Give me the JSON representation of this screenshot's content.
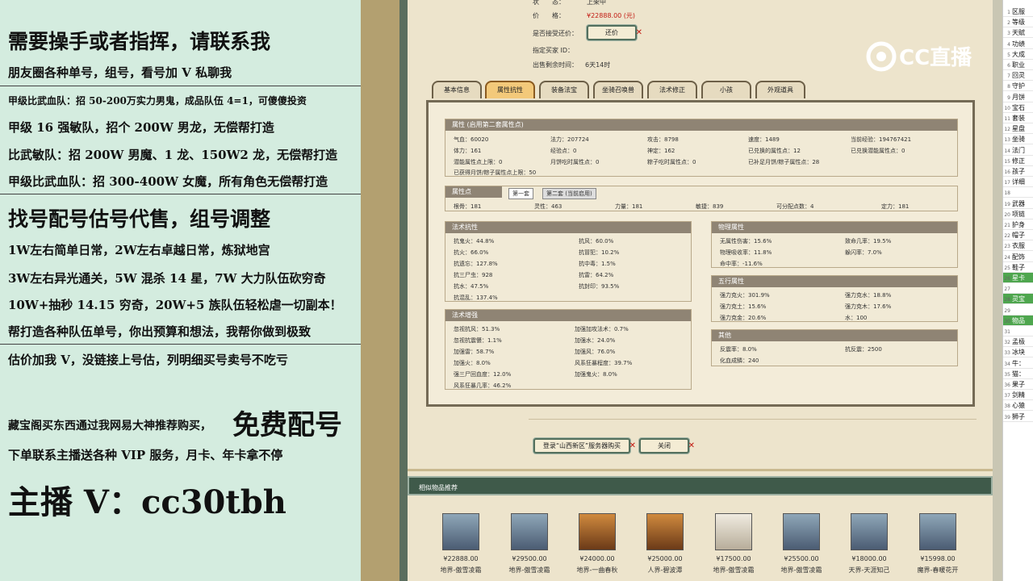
{
  "left": {
    "lines": [
      "需要操手或者指挥，请联系我",
      "朋友圈各种单号，组号，看号加 V 私聊我",
      "甲级比武血队：招 50-200万实力男鬼，成品队伍 4=1，可傻傻投资",
      "甲级 16 强敏队，招个 200W 男龙，无偿帮打造",
      "比武敏队：招 200W 男魔、1 龙、150W2 龙，无偿帮打造",
      "甲级比武血队：招 300-400W 女魔，所有角色无偿帮打造",
      "找号配号估号代售，组号调整",
      "1W左右简单日常，2W左右卓越日常，炼狱地宫",
      "3W左右异光通关，5W 混杀 14 星，7W 大力队伍砍穷奇",
      "10W+抽秒 14.15 穷奇，20W+5 族队伍轻松虐一切副本！",
      "帮打造各种队伍单号，你出预算和想法，我帮你做到极致",
      "估价加我 V，没链接上号估，列明细买号卖号不吃亏",
      "藏宝阁买东西通过我网易大神推荐购买，",
      "免费配号",
      "下单联系主播送各种 VIP 服务，月卡、年卡拿不停",
      "主播 V：cc30tbh"
    ]
  },
  "top": {
    "status_label": "状　　态：",
    "status_value": "上架中",
    "price_label": "价　　格：",
    "price_value": "¥22888.00 (元)",
    "counter_label": "是否接受还价：",
    "counter_btn": "还价",
    "buyer_label": "指定买家 ID：",
    "remain_label": "出售剩余时间：",
    "remain_value": "6天14时"
  },
  "tabs": [
    "基本信息",
    "属性抗性",
    "装备法宝",
    "坐骑召唤兽",
    "法术修正",
    "小孩",
    "外观道具"
  ],
  "attr": {
    "header": "属性 (启用第二套属性点)",
    "rows": [
      [
        [
          "气血：60020"
        ],
        [
          "法力：207724"
        ],
        [
          "攻击：8798"
        ],
        [
          "速度：1489"
        ],
        [
          "当前经验：194767421"
        ]
      ],
      [
        [
          "体力：161"
        ],
        [
          "经验点：0"
        ],
        [
          "神定：162"
        ],
        [
          "已兑换的属性点：12"
        ],
        [
          "已兑换潜能属性点：0"
        ]
      ],
      [
        [
          "潜能属性点上限：0"
        ],
        [
          "月饼吃时属性点：0"
        ],
        [
          "粽子吃时属性点：0"
        ],
        [
          "已补足月饼/粽子属性点：28"
        ]
      ],
      [
        [
          "已获得月饼/粽子属性点上限：50"
        ]
      ]
    ]
  },
  "points": {
    "header": "属性点",
    "sub_tabs": [
      "第一套",
      "第二套 (当前启用)"
    ],
    "cells": [
      "根骨：181",
      "灵性：463",
      "力量：181",
      "敏捷：839",
      "可分配点数：4",
      "定力：181"
    ]
  },
  "resist": {
    "header": "法术抗性",
    "cells": [
      "抗鬼火：44.8%",
      "抗风：60.0%",
      "抗火：66.0%",
      "抗冒犯：10.2%",
      "抗遗忘：127.8%",
      "抗中毒：1.5%",
      "抗三尸虫：928",
      "抗雷：64.2%",
      "抗水：47.5%",
      "抗封印：93.5%",
      "抗混乱：137.4%"
    ]
  },
  "boost": {
    "header": "法术增强",
    "cells": [
      "忽视抗风：51.3%",
      "加强加攻法术：0.7%",
      "忽视抗震慑：1.1%",
      "加强水：24.0%",
      "加强雷：58.7%",
      "加强风：76.0%",
      "加强火：8.0%",
      "风系狂暴程度：39.7%",
      "强三尸回血度：12.0%",
      "加强鬼火：8.0%",
      "风系狂暴几率：46.2%"
    ]
  },
  "phys": {
    "header": "物理属性",
    "cells": [
      "无属性伤害：15.6%",
      "致命几率：19.5%",
      "物理吸收率：11.8%",
      "躲闪率：7.0%",
      "命中率：-11.6%"
    ]
  },
  "wuxing": {
    "header": "五行属性",
    "cells": [
      "强力克火：301.9%",
      "强力克水：18.8%",
      "强力克土：15.6%",
      "强力克木：17.6%",
      "强力克金：20.6%",
      "水：100"
    ]
  },
  "other": {
    "header": "其他",
    "cells": [
      "反震率：8.0%",
      "抗反震：2500",
      "化血成鳞：240"
    ]
  },
  "buttons": {
    "login": "登录“山西新区”服务器购买",
    "close": "关闭"
  },
  "recommend": {
    "title": "相似物品推荐",
    "items": [
      {
        "price": "¥22888.00",
        "name": "地界-傲雪凌霜"
      },
      {
        "price": "¥29500.00",
        "name": "地界-傲雪凌霜"
      },
      {
        "price": "¥24000.00",
        "name": "地界-一曲春秋"
      },
      {
        "price": "¥25000.00",
        "name": "人界-碧波潭"
      },
      {
        "price": "¥17500.00",
        "name": "地界-傲雪凌霜"
      },
      {
        "price": "¥25500.00",
        "name": "地界-傲雪凌霜"
      },
      {
        "price": "¥18000.00",
        "name": "天界-天涯知己"
      },
      {
        "price": "¥15998.00",
        "name": "魔界-春暖花开"
      }
    ]
  },
  "logo_text": "CC直播",
  "sidebar": [
    "区服",
    "等级",
    "天赋",
    "功绩",
    "大成",
    "职业",
    "回灵",
    "守护",
    "月饼",
    "宝石",
    "套装",
    "星盘",
    "坐骑",
    "法门",
    "修正",
    "孩子",
    "详细",
    "",
    "武器",
    "项链",
    "护身",
    "帽子",
    "衣服",
    "配饰",
    "鞋子",
    "星卡",
    "",
    "灵宝",
    "",
    "物品",
    "",
    "孟极",
    "冰块",
    "牛：",
    "猫：",
    "果子",
    "剑精",
    "心猿",
    "狮子"
  ]
}
